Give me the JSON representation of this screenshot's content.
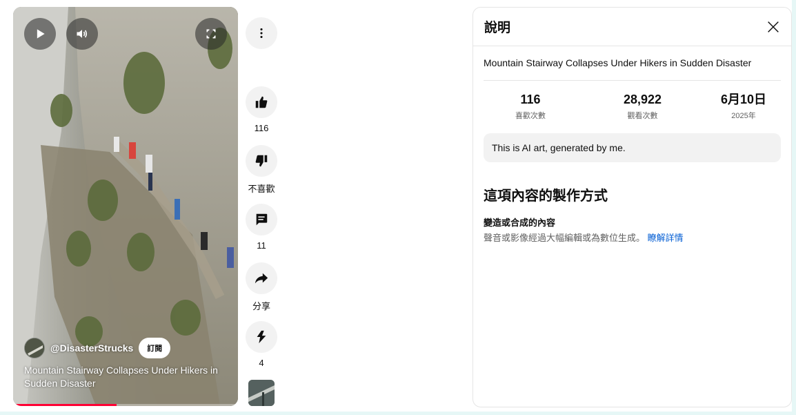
{
  "player": {
    "play_icon": "play-icon",
    "volume_icon": "volume-icon",
    "fullscreen_icon": "fullscreen-icon",
    "channel_handle": "@DisasterStrucks",
    "subscribe_label": "訂閱",
    "video_title": "Mountain Stairway Collapses Under Hikers in Sudden Disaster",
    "progress": 0.46
  },
  "actions": {
    "more_icon": "more-vert-icon",
    "like_count": "116",
    "dislike_label": "不喜歡",
    "comment_count": "11",
    "share_label": "分享",
    "remix_count": "4"
  },
  "panel": {
    "title": "說明",
    "video_title": "Mountain Stairway Collapses Under Hikers in Sudden Disaster",
    "stats": {
      "likes_value": "116",
      "likes_label": "喜歡次數",
      "views_value": "28,922",
      "views_label": "觀看次數",
      "date_value": "6月10日",
      "date_year": "2025年"
    },
    "note": "This is AI art, generated by me.",
    "how_made_heading": "這項內容的製作方式",
    "ai_label_title": "變造或合成的內容",
    "ai_label_desc": "聲音或影像經過大幅編輯或為數位生成。",
    "learn_more": "瞭解詳情"
  },
  "colors": {
    "accent_link": "#065fd4",
    "progress": "#ff0033",
    "frame_tint": "#e6f7f6"
  }
}
